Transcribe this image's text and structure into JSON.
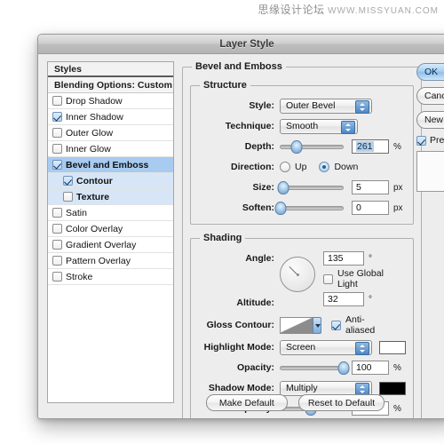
{
  "watermark": {
    "cn": "思缘设计论坛",
    "url": "WWW.MISSYUAN.COM"
  },
  "window": {
    "title": "Layer Style"
  },
  "sidebar": {
    "header": "Styles",
    "blending": "Blending Options: Custom",
    "effects": [
      {
        "label": "Drop Shadow",
        "checked": false,
        "selected": false,
        "child": false
      },
      {
        "label": "Inner Shadow",
        "checked": true,
        "selected": false,
        "child": false
      },
      {
        "label": "Outer Glow",
        "checked": false,
        "selected": false,
        "child": false
      },
      {
        "label": "Inner Glow",
        "checked": false,
        "selected": false,
        "child": false
      },
      {
        "label": "Bevel and Emboss",
        "checked": true,
        "selected": true,
        "child": false
      },
      {
        "label": "Contour",
        "checked": true,
        "selected": true,
        "child": true
      },
      {
        "label": "Texture",
        "checked": false,
        "selected": true,
        "child": true
      },
      {
        "label": "Satin",
        "checked": false,
        "selected": false,
        "child": false
      },
      {
        "label": "Color Overlay",
        "checked": false,
        "selected": false,
        "child": false
      },
      {
        "label": "Gradient Overlay",
        "checked": false,
        "selected": false,
        "child": false
      },
      {
        "label": "Pattern Overlay",
        "checked": false,
        "selected": false,
        "child": false
      },
      {
        "label": "Stroke",
        "checked": false,
        "selected": false,
        "child": false
      }
    ]
  },
  "panel": {
    "title": "Bevel and Emboss",
    "structure": {
      "legend": "Structure",
      "style_label": "Style:",
      "style_value": "Outer Bevel",
      "technique_label": "Technique:",
      "technique_value": "Smooth",
      "depth_label": "Depth:",
      "depth_value": "261",
      "depth_unit": "%",
      "depth_percent": 26,
      "direction_label": "Direction:",
      "direction_up": "Up",
      "direction_down": "Down",
      "direction_selected": "Down",
      "size_label": "Size:",
      "size_value": "5",
      "size_unit": "px",
      "size_percent": 5,
      "soften_label": "Soften:",
      "soften_value": "0",
      "soften_unit": "px",
      "soften_percent": 1
    },
    "shading": {
      "legend": "Shading",
      "angle_label": "Angle:",
      "angle_value": "135",
      "angle_unit": "°",
      "global_light_label": "Use Global Light",
      "global_light_checked": false,
      "altitude_label": "Altitude:",
      "altitude_value": "32",
      "altitude_unit": "°",
      "gloss_label": "Gloss Contour:",
      "antialiased_label": "Anti-aliased",
      "antialiased_checked": true,
      "highlight_label": "Highlight Mode:",
      "highlight_value": "Screen",
      "highlight_color": "#ffffff",
      "highlight_opacity_label": "Opacity:",
      "highlight_opacity_value": "100",
      "highlight_opacity_unit": "%",
      "highlight_opacity_percent": 100,
      "shadow_label": "Shadow Mode:",
      "shadow_value": "Multiply",
      "shadow_color": "#000000",
      "shadow_opacity_label": "Opacity:",
      "shadow_opacity_value": "49",
      "shadow_opacity_unit": "%",
      "shadow_opacity_percent": 49
    }
  },
  "footer": {
    "make_default": "Make Default",
    "reset_default": "Reset to Default"
  },
  "right": {
    "ok": "OK",
    "cancel": "Cancel",
    "new_style": "New Style...",
    "preview": "Preview",
    "preview_checked": true
  }
}
